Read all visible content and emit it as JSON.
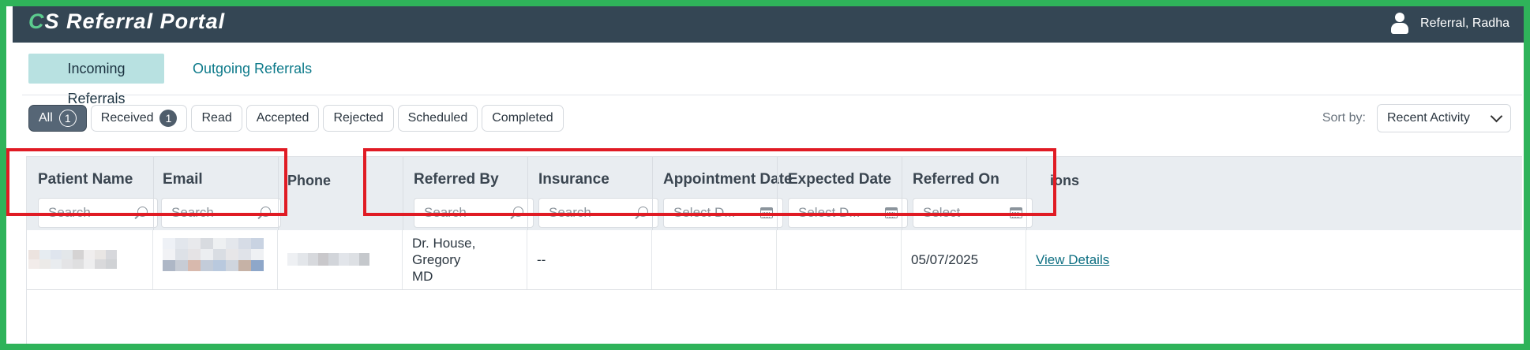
{
  "header": {
    "logo_c": "C",
    "logo_rest": "S Referral Portal",
    "user_name": "Referral, Radha",
    "user_icon": "user-icon"
  },
  "tabs": [
    {
      "label": "Incoming Referrals",
      "active": true
    },
    {
      "label": "Outgoing Referrals",
      "active": false
    }
  ],
  "filters": {
    "all": {
      "label": "All",
      "count": "1"
    },
    "received": {
      "label": "Received",
      "count": "1"
    },
    "read": "Read",
    "accepted": "Accepted",
    "rejected": "Rejected",
    "scheduled": "Scheduled",
    "completed": "Completed"
  },
  "sort": {
    "label": "Sort by:",
    "value": "Recent Activity"
  },
  "columns": [
    {
      "label": "Patient Name",
      "placeholder": "Search",
      "icon": "search-icon"
    },
    {
      "label": "Email",
      "placeholder": "Search",
      "icon": "search-icon"
    },
    {
      "label": "Phone"
    },
    {
      "label": "Referred By",
      "placeholder": "Search",
      "icon": "search-icon"
    },
    {
      "label": "Insurance",
      "placeholder": "Search",
      "icon": "search-icon"
    },
    {
      "label": "Appointment Date",
      "placeholder": "Select D...",
      "icon": "calendar-icon"
    },
    {
      "label": "Expected Date",
      "placeholder": "Select D...",
      "icon": "calendar-icon"
    },
    {
      "label": "Referred On",
      "placeholder": "Select",
      "icon": "calendar-icon"
    },
    {
      "label": "ions"
    }
  ],
  "rows": [
    {
      "referred_by_line1": "Dr. House, Gregory",
      "referred_by_line2": "MD",
      "insurance": "--",
      "referred_on": "05/07/2025",
      "action": "View Details"
    }
  ],
  "colors": {
    "topbar": "#344654",
    "accent": "#0d7a8a",
    "active_tab": "#b8e1e1",
    "highlight": "#e01b24",
    "frame": "#2fb35a"
  }
}
